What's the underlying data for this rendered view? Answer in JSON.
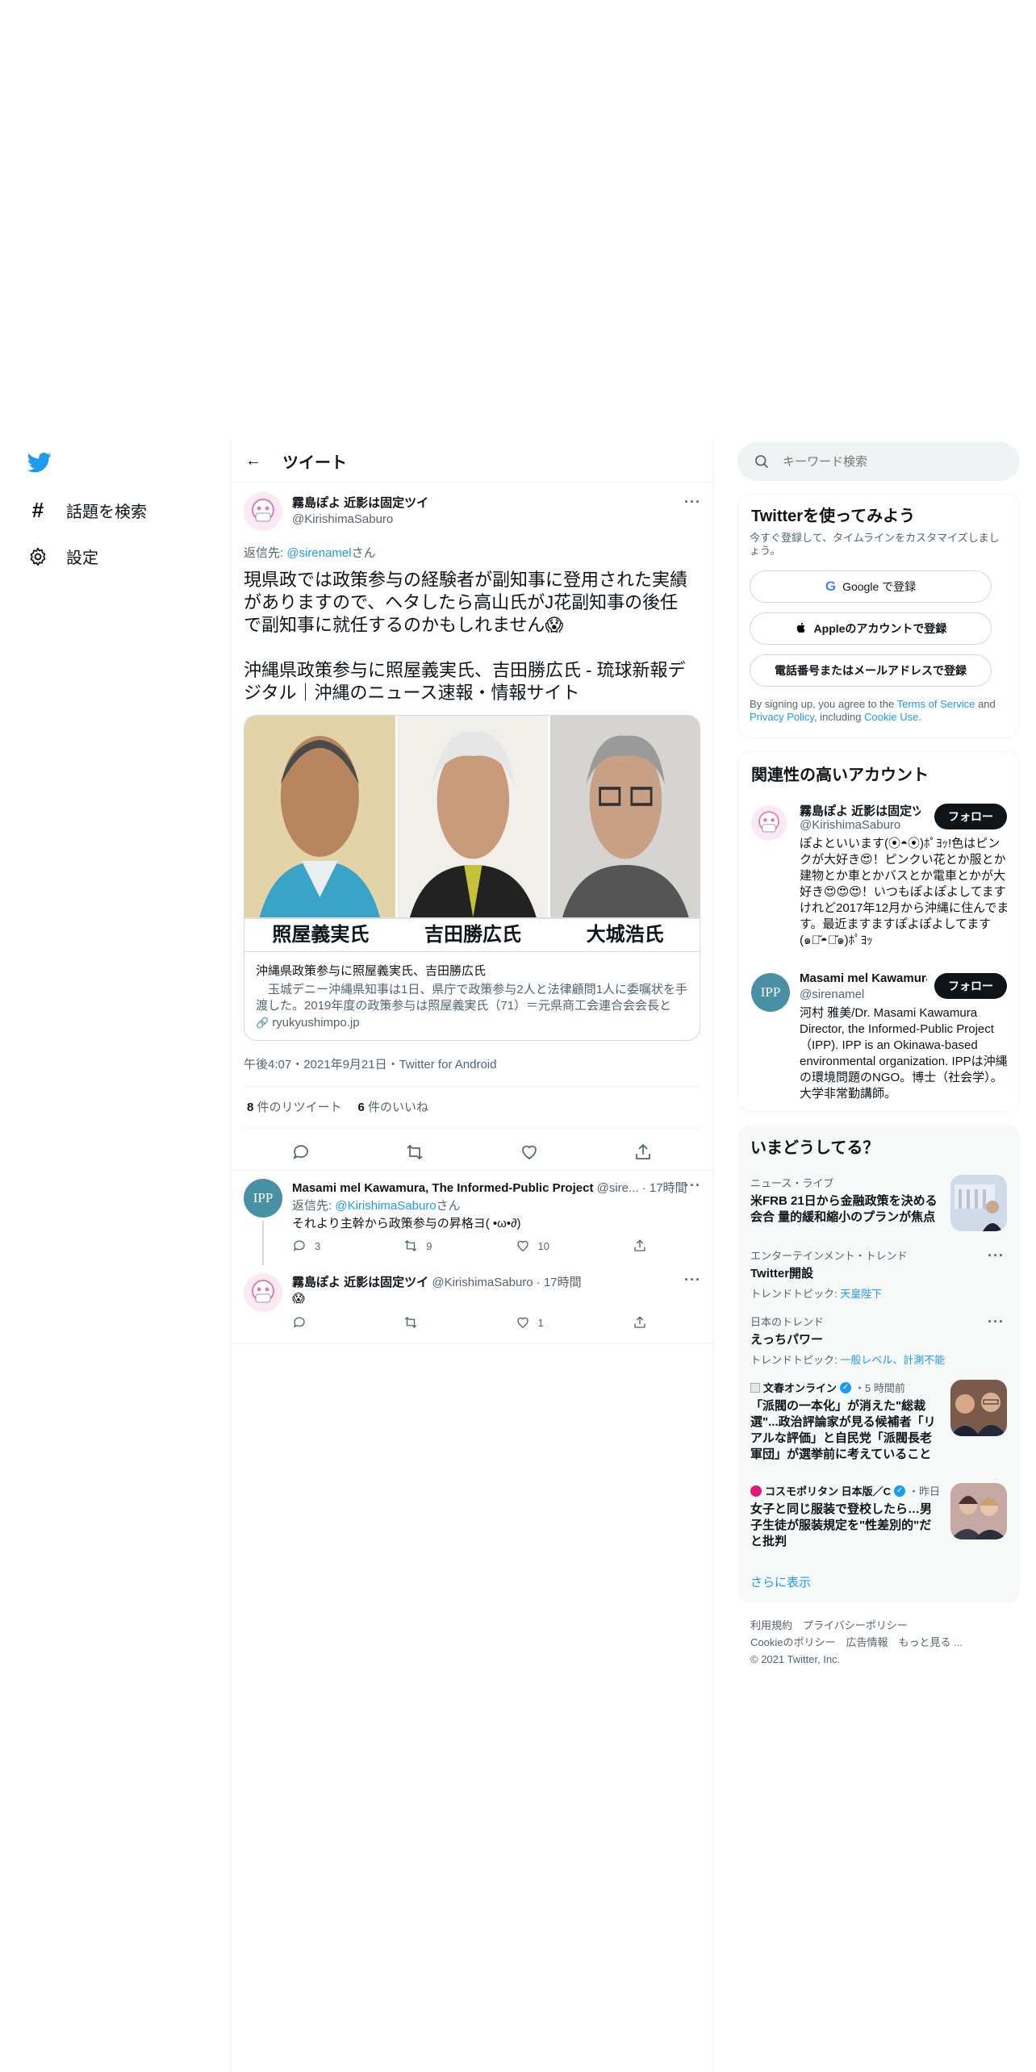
{
  "nav": {
    "explore_label": "話題を検索",
    "settings_label": "設定"
  },
  "header": {
    "title": "ツイート"
  },
  "tweet": {
    "author_name": "霧島ぽよ 近影は固定ツイ",
    "author_handle": "@KirishimaSaburo",
    "reply_prefix": "返信先: ",
    "reply_to": "@sirenamel",
    "reply_suffix": "さん",
    "text_line1": "現県政では政策参与の経験者が副知事に登用された実績がありますので、ヘタしたら高山氏がJ花副知事の後任で副知事に就任するのかもしれません😱",
    "text_line2": "沖縄県政策参与に照屋義実氏、吉田勝広氏 - 琉球新報デジタル｜沖縄のニュース速報・情報サイト",
    "card_captions": [
      "照屋義実氏",
      "吉田勝広氏",
      "大城浩氏"
    ],
    "card_title": "沖縄県政策参与に照屋義実氏、吉田勝広氏",
    "card_desc": "　玉城デニー沖縄県知事は1日、県庁で政策参与2人と法律顧問1人に委嘱状を手渡した。2019年度の政策参与は照屋義実氏（71）＝元県商工会連合会会長と吉...",
    "card_domain": "ryukyushimpo.jp",
    "timestamp": "午後4:07・2021年9月21日・Twitter for Android",
    "retweets_count": "8",
    "retweets_label": " 件のリツイート",
    "likes_count": "6",
    "likes_label": " 件のいいね"
  },
  "replies": [
    {
      "name": "Masami mel Kawamura, The Informed-Public Project",
      "handle": "@sire...",
      "time": "17時間",
      "reply_prefix": "返信先: ",
      "reply_to": "@KirishimaSaburo",
      "reply_suffix": "さん",
      "text": "それより主幹から政策参与の昇格ヨ( •ω•∂)",
      "replies": "3",
      "retweets": "9",
      "likes": "10",
      "avatar_text": "IPP"
    },
    {
      "name": "霧島ぽよ 近影は固定ツイ",
      "handle": "@KirishimaSaburo",
      "time": "17時間",
      "text": "😱",
      "replies": "",
      "retweets": "",
      "likes": "1"
    }
  ],
  "search": {
    "placeholder": "キーワード検索"
  },
  "signup": {
    "title": "Twitterを使ってみよう",
    "subtitle": "今すぐ登録して、タイムラインをカスタマイズしましょう。",
    "google_label": "Google で登録",
    "apple_label": "Appleのアカウントで登録",
    "phone_label": "電話番号またはメールアドレスで登録",
    "terms_prefix": "By signing up, you agree to the ",
    "terms_link": "Terms of Service",
    "terms_and": " and ",
    "privacy_link": "Privacy Policy",
    "terms_including": ", including ",
    "cookie_link": "Cookie Use",
    "terms_end": "."
  },
  "related": {
    "title": "関連性の高いアカウント",
    "follow_label": "フォロー",
    "accounts": [
      {
        "name": "霧島ぽよ 近影は固定ツ",
        "handle": "@KirishimaSaburo",
        "bio": "ぽよといいます(⦿◓⦿)ﾎﾟﾖｯ!色はピンクが大好き😍！ピンクい花とか服とか建物とか車とかバスとか電車とかが大好き😍😍😍！いつもぽよぽよしてますけれど2017年12月から沖縄に住んでます。最近ますますぽよぽよしてます(๑･̆◓･̆๑)ﾎﾟﾖｯ"
      },
      {
        "name": "Masami mel Kawamura",
        "handle": "@sirenamel",
        "bio": "河村 雅美/Dr. Masami Kawamura Director, the Informed-Public Project（IPP). IPP is an Okinawa-based environmental organization. IPPは沖縄の環境問題のNGO。博士（社会学）。大学非常勤講師。",
        "avatar_text": "IPP"
      }
    ]
  },
  "trends": {
    "title": "いまどうしてる？",
    "items": [
      {
        "meta": "ニュース・ライブ",
        "title": "米FRB 21日から金融政策を決める会合 量的緩和縮小のプランが焦点"
      },
      {
        "meta": "エンターテインメント・トレンド",
        "title": "Twitter開設",
        "topic_prefix": "トレンドトピック: ",
        "topic": "天皇陛下"
      },
      {
        "meta": "日本のトレンド",
        "title": "えっちパワー",
        "topic_prefix": "トレンドトピック: ",
        "topic": "一般レベル、計測不能"
      },
      {
        "source": "文春オンライン",
        "time": "・5 時間前",
        "title": "「派閥の一本化」が消えた\"総裁選\"...政治評論家が見る候補者「リアルな評価」と自民党「派閥長老軍団」が選挙前に考えていること"
      },
      {
        "source": "コスモポリタン 日本版／C",
        "time": "・昨日",
        "title": "女子と同じ服装で登校したら…男子生徒が服装規定を\"性差別的\"だと批判"
      }
    ],
    "show_more": "さらに表示"
  },
  "footer": {
    "line1": "利用規約　プライバシーポリシー",
    "line2": "Cookieのポリシー　広告情報　もっと見る ...",
    "line3": "© 2021 Twitter, Inc."
  },
  "colors": {
    "accent": "#1d9bf0",
    "text": "#0f1419",
    "muted": "#536471",
    "border": "#eff3f4"
  }
}
